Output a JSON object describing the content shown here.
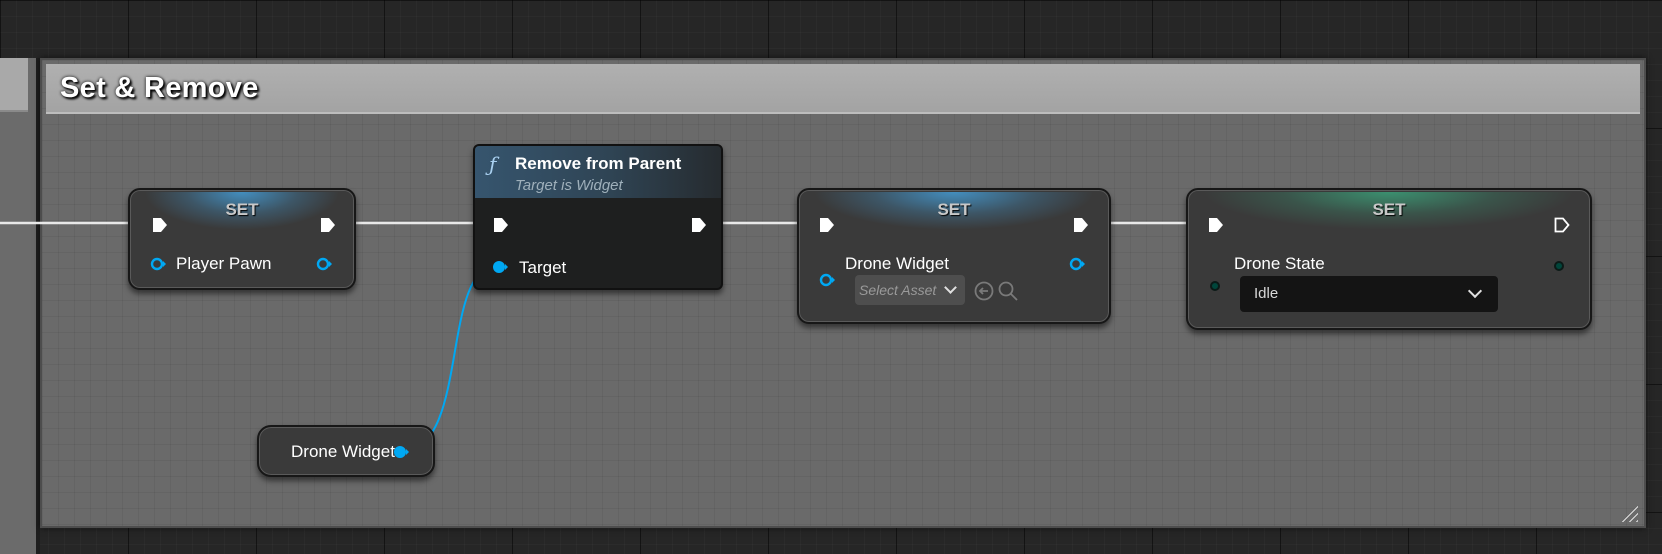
{
  "comment": {
    "title": "Set & Remove"
  },
  "nodes": {
    "set_player_pawn": {
      "title": "SET",
      "var_label": "Player Pawn"
    },
    "remove_from_parent": {
      "icon": "function-icon",
      "title": "Remove from Parent",
      "subtitle": "Target is Widget",
      "target_label": "Target"
    },
    "drone_widget_getter": {
      "label": "Drone Widget"
    },
    "set_drone_widget": {
      "title": "SET",
      "var_label": "Drone Widget",
      "asset_placeholder": "Select Asset"
    },
    "set_drone_state": {
      "title": "SET",
      "var_label": "Drone State",
      "enum_value": "Idle"
    }
  },
  "colors": {
    "exec_pin": "#ffffff",
    "object_pin": "#00a8f3",
    "enum_pin": "#00463b",
    "comment_bg": "#6a6a6a",
    "comment_header": "#a9a9a9"
  }
}
